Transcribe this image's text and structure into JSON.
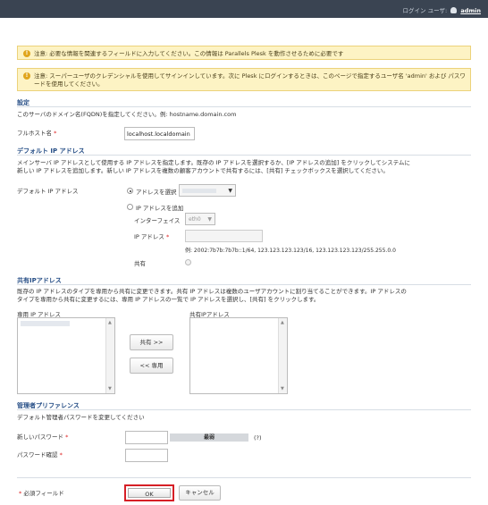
{
  "topbar": {
    "login_label": "ログイン ユーザ:",
    "username": "admin"
  },
  "notices": [
    "注意: 必要な情報を関連するフィールドに入力してください。この情報は Parallels Plesk を動作させるために必要です",
    "注意: スーパーユーザのクレデンシャルを使用してサインインしています。次に Plesk にログインするときは、このページで指定するユーザ名 'admin' および パスワードを使用してください。"
  ],
  "settings": {
    "heading": "設定",
    "desc": "このサーバのドメイン名(FQDN)を指定してください。例: hostname.domain.com",
    "fullhost_label": "フルホスト名",
    "fullhost_value": "localhost.localdomain"
  },
  "default_ip": {
    "heading": "デフォルト IP アドレス",
    "desc1": "メインサーバ IP アドレスとして使用する IP アドレスを指定します。既存の IP アドレスを選択するか、[IP アドレスの追加] をクリックしてシステムに",
    "desc2": "新しい IP アドレスを追加します。新しい IP アドレスを複数の顧客アカウントで共有するには、[共有] チェックボックスを選択してください。",
    "label": "デフォルト IP アドレス",
    "option_select": "アドレスを選択",
    "option_add": "IP アドレスを追加",
    "interface_label": "インターフェイス",
    "interface_value": "eth0",
    "ip_label": "IP アドレス",
    "example": "例: 2002:7b7b:7b7b::1/64, 123.123.123.123/16, 123.123.123.123/255.255.0.0",
    "shared_label": "共有"
  },
  "shared_ip": {
    "heading": "共有IPアドレス",
    "desc1": "既存の IP アドレスのタイプを専用から共有に変更できます。共有 IP アドレスは複数のユーザアカウントに割り当てることができます。IP アドレスの",
    "desc2": "タイプを専用から共有に変更するには、専用 IP アドレスの一覧で IP アドレスを選択し、[共有] をクリックします。",
    "dedicated_label": "専用 IP アドレス",
    "shared_label": "共有IPアドレス",
    "share_button": "共有 >>",
    "dedicate_button": "<< 専用"
  },
  "admin": {
    "heading": "管理者プリファレンス",
    "desc": "デフォルト管理者パスワードを変更してください",
    "new_password_label": "新しいパスワード",
    "strength": "最弱",
    "help": "(?)",
    "confirm_label": "パスワード確認"
  },
  "footer": {
    "required_note": "必須フィールド",
    "ok_button": "OK",
    "cancel_button": "キャンセル"
  }
}
